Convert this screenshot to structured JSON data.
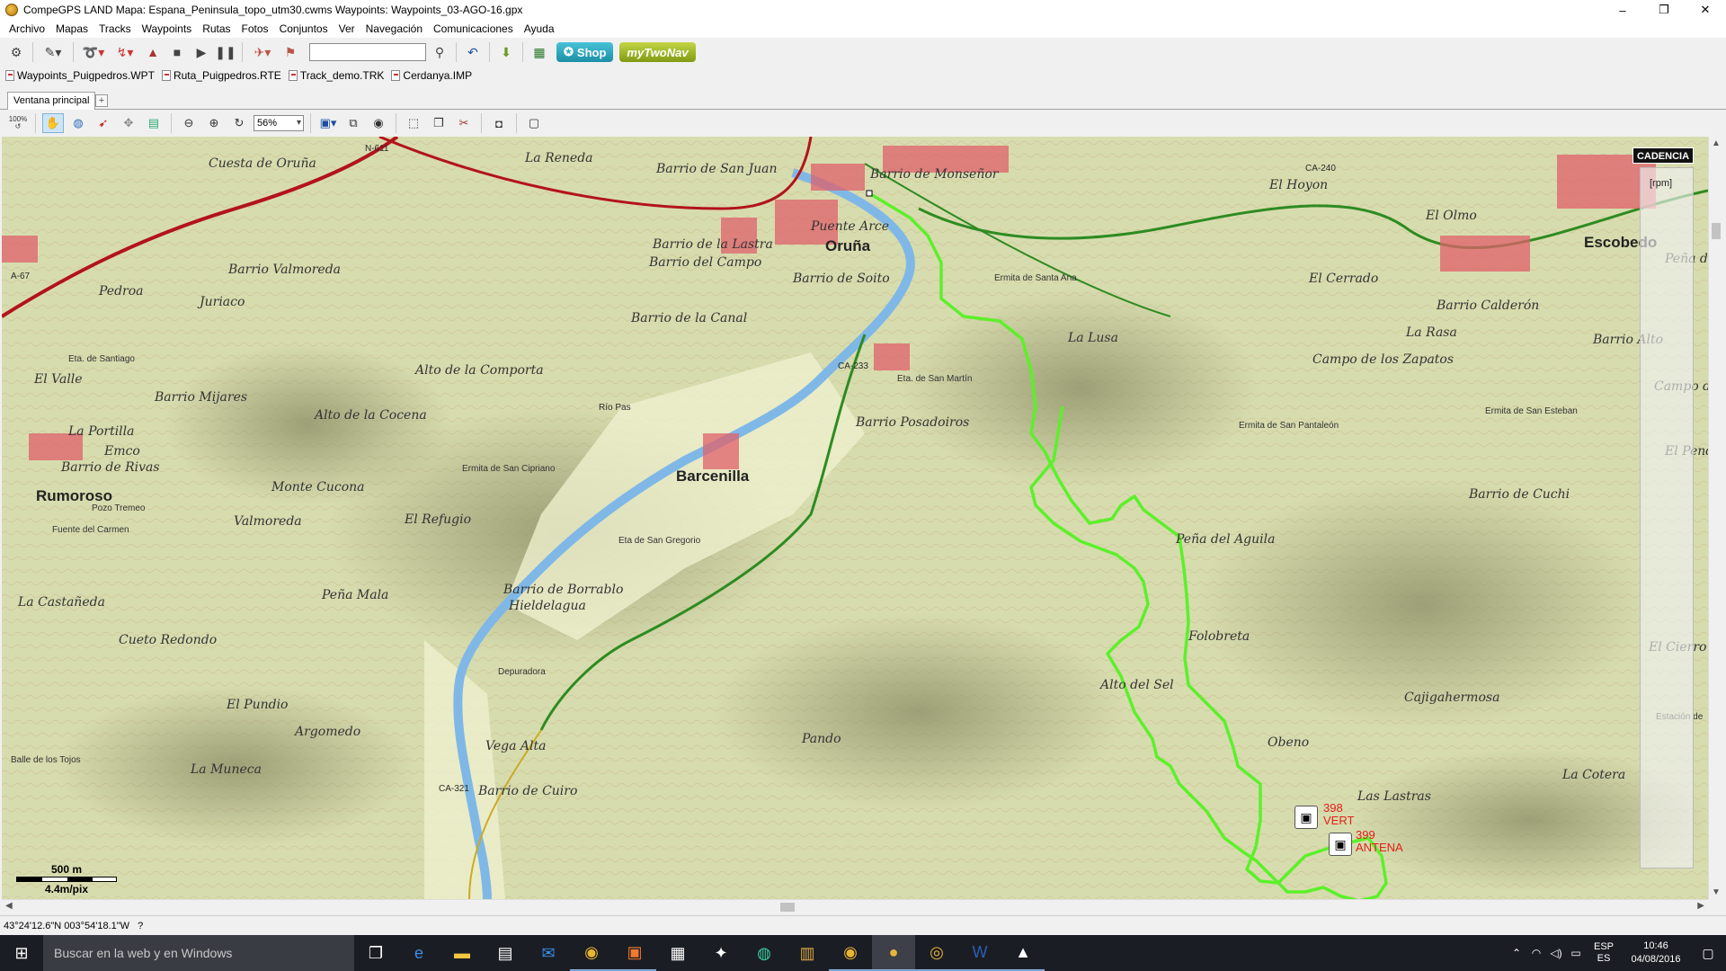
{
  "window": {
    "title": "CompeGPS LAND Mapa: Espana_Peninsula_topo_utm30.cwms Waypoints: Waypoints_03-AGO-16.gpx",
    "minimize": "–",
    "restore": "❐",
    "close": "✕"
  },
  "menu": [
    "Archivo",
    "Mapas",
    "Tracks",
    "Waypoints",
    "Rutas",
    "Fotos",
    "Conjuntos",
    "Ver",
    "Navegación",
    "Comunicaciones",
    "Ayuda"
  ],
  "toolbar": {
    "shop_label": "Shop",
    "mytwonav_label": "myTwoNav"
  },
  "files": [
    "Waypoints_Puigpedros.WPT",
    "Ruta_Puigpedros.RTE",
    "Track_demo.TRK",
    "Cerdanya.IMP"
  ],
  "tabs": {
    "main": "Ventana principal",
    "add": "+"
  },
  "map_toolbar": {
    "zoom_value": "56%",
    "zoom_100": "100%"
  },
  "map": {
    "places": [
      {
        "name": "Cuesta de Oruña"
      },
      {
        "name": "La Reneda"
      },
      {
        "name": "Barrio de San Juan"
      },
      {
        "name": "Barrio de Monseñor"
      },
      {
        "name": "El Hoyon"
      },
      {
        "name": "El Olmo"
      },
      {
        "name": "Escobedo"
      },
      {
        "name": "Peña del"
      },
      {
        "name": "Barrio Valmoreda"
      },
      {
        "name": "Barrio de la Lastra"
      },
      {
        "name": "Barrio del Campo"
      },
      {
        "name": "Oruña"
      },
      {
        "name": "Puente Arce"
      },
      {
        "name": "Ermita de Santa Ana"
      },
      {
        "name": "El Cerrado"
      },
      {
        "name": "Barrio Calderón"
      },
      {
        "name": "Pedroa"
      },
      {
        "name": "Juriaco"
      },
      {
        "name": "Barrio de Soito"
      },
      {
        "name": "Barrio de la Canal"
      },
      {
        "name": "La Rasa"
      },
      {
        "name": "Barrio Alto"
      },
      {
        "name": "Eta. de Santiago"
      },
      {
        "name": "La Lusa"
      },
      {
        "name": "Campo de los Zapatos"
      },
      {
        "name": "El Valle"
      },
      {
        "name": "Alto de la Comporta"
      },
      {
        "name": "Eta. de San Martín"
      },
      {
        "name": "Campo de"
      },
      {
        "name": "Barrio Mijares"
      },
      {
        "name": "Alto de la Cocena"
      },
      {
        "name": "Barrio Posadoiros"
      },
      {
        "name": "Ermita de San Esteban"
      },
      {
        "name": "La Portilla"
      },
      {
        "name": "Ermita de San Pantaleón"
      },
      {
        "name": "Emco"
      },
      {
        "name": "Barrio de Rivas"
      },
      {
        "name": "El Pendo"
      },
      {
        "name": "Ermita de San Cipriano"
      },
      {
        "name": "Barcenilla"
      },
      {
        "name": "Monte Cucona"
      },
      {
        "name": "Rumoroso"
      },
      {
        "name": "Pozo Tremeo"
      },
      {
        "name": "Barrio de Cuchi"
      },
      {
        "name": "Valmoreda"
      },
      {
        "name": "El Refugio"
      },
      {
        "name": "Fuente del Carmen"
      },
      {
        "name": "Eta de San Gregorio"
      },
      {
        "name": "Peña del Aguila"
      },
      {
        "name": "Barrio de Borrablo"
      },
      {
        "name": "La Castañeda"
      },
      {
        "name": "Hieldelagua"
      },
      {
        "name": "Peña Mala"
      },
      {
        "name": "Cueto Redondo"
      },
      {
        "name": "Folobreta"
      },
      {
        "name": "El Cierro"
      },
      {
        "name": "Depuradora"
      },
      {
        "name": "Alto del Sel"
      },
      {
        "name": "Cajigahermosa"
      },
      {
        "name": "El Pundio"
      },
      {
        "name": "Argomedo"
      },
      {
        "name": "Pando"
      },
      {
        "name": "Obeno"
      },
      {
        "name": "Vega Alta"
      },
      {
        "name": "La Muneca"
      },
      {
        "name": "Barrio de Cuiro"
      },
      {
        "name": "Las Lastras"
      },
      {
        "name": "La Cotera"
      },
      {
        "name": "Balle de los Tojos"
      },
      {
        "name": "Estación de"
      }
    ],
    "road_labels": [
      "A-67",
      "N-611",
      "CA-240",
      "CA-233",
      "CA-321",
      "Río Pas"
    ],
    "waypoints": [
      {
        "id": "398",
        "label": "VERT"
      },
      {
        "id": "399",
        "label": "ANTENA"
      }
    ],
    "cadencia_title": "CADENCIA",
    "cadencia_unit": "[rpm]",
    "scale_distance": "500 m",
    "scale_resolution": "4.4m/pix",
    "colors": {
      "track": "#5cf02a",
      "road_main": "#b3131b",
      "road_secondary": "#2e8b22",
      "river": "#7fb8e6",
      "town": "#e0606a"
    }
  },
  "status": {
    "coordinates": "43°24'12.6\"N 003°54'18.1\"W",
    "extra": "?"
  },
  "taskbar": {
    "search_placeholder": "Buscar en la web y en Windows",
    "lang_top": "ESP",
    "lang_bottom": "ES",
    "time": "10:46",
    "date": "04/08/2016"
  }
}
